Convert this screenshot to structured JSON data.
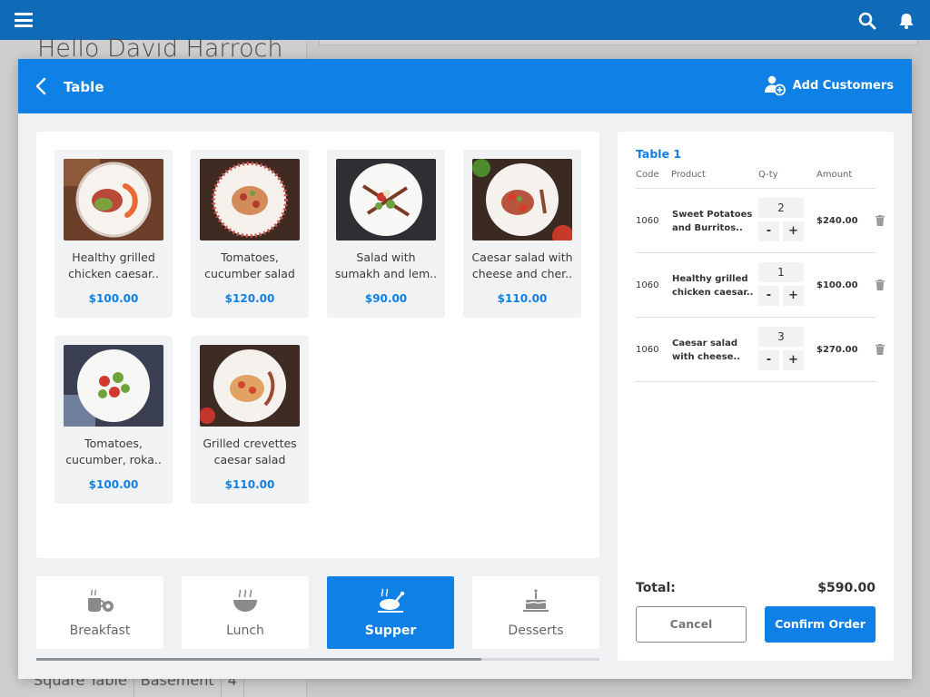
{
  "background": {
    "greeting": "Hello David Harroch",
    "bottom_row": [
      "Square Table",
      "Basement",
      "4"
    ]
  },
  "modal": {
    "title": "Table",
    "add_customers_label": "Add Customers"
  },
  "products": [
    {
      "name": "Healthy grilled\nchicken caesar..",
      "price": "$100.00"
    },
    {
      "name": "Tomatoes,\ncucumber salad",
      "price": "$120.00"
    },
    {
      "name": "Salad with\nsumakh and lem..",
      "price": "$90.00"
    },
    {
      "name": "Caesar salad with\ncheese and cher..",
      "price": "$110.00"
    },
    {
      "name": "Tomatoes,\ncucumber, roka..",
      "price": "$100.00"
    },
    {
      "name": "Grilled crevettes\ncaesar salad",
      "price": "$110.00"
    }
  ],
  "categories": [
    {
      "label": "Breakfast",
      "icon": "breakfast-icon",
      "active": false
    },
    {
      "label": "Lunch",
      "icon": "soup-bowl-icon",
      "active": false
    },
    {
      "label": "Supper",
      "icon": "roast-chicken-icon",
      "active": true
    },
    {
      "label": "Desserts",
      "icon": "cake-icon",
      "active": false
    }
  ],
  "order": {
    "table_label": "Table 1",
    "headers": {
      "code": "Code",
      "product": "Product",
      "qty": "Q-ty",
      "amount": "Amount"
    },
    "rows": [
      {
        "code": "1060",
        "product": "Sweet Potatoes\nand Burritos..",
        "qty": "2",
        "amount": "$240.00"
      },
      {
        "code": "1060",
        "product": "Healthy grilled\nchicken caesar..",
        "qty": "1",
        "amount": "$100.00"
      },
      {
        "code": "1060",
        "product": "Caesar salad\nwith cheese..",
        "qty": "3",
        "amount": "$270.00"
      }
    ],
    "minus_label": "-",
    "plus_label": "+",
    "total_label": "Total:",
    "total_value": "$590.00",
    "cancel_label": "Cancel",
    "confirm_label": "Confirm Order"
  },
  "colors": {
    "primary": "#0f80e6",
    "topbar": "#0f6ab8"
  }
}
